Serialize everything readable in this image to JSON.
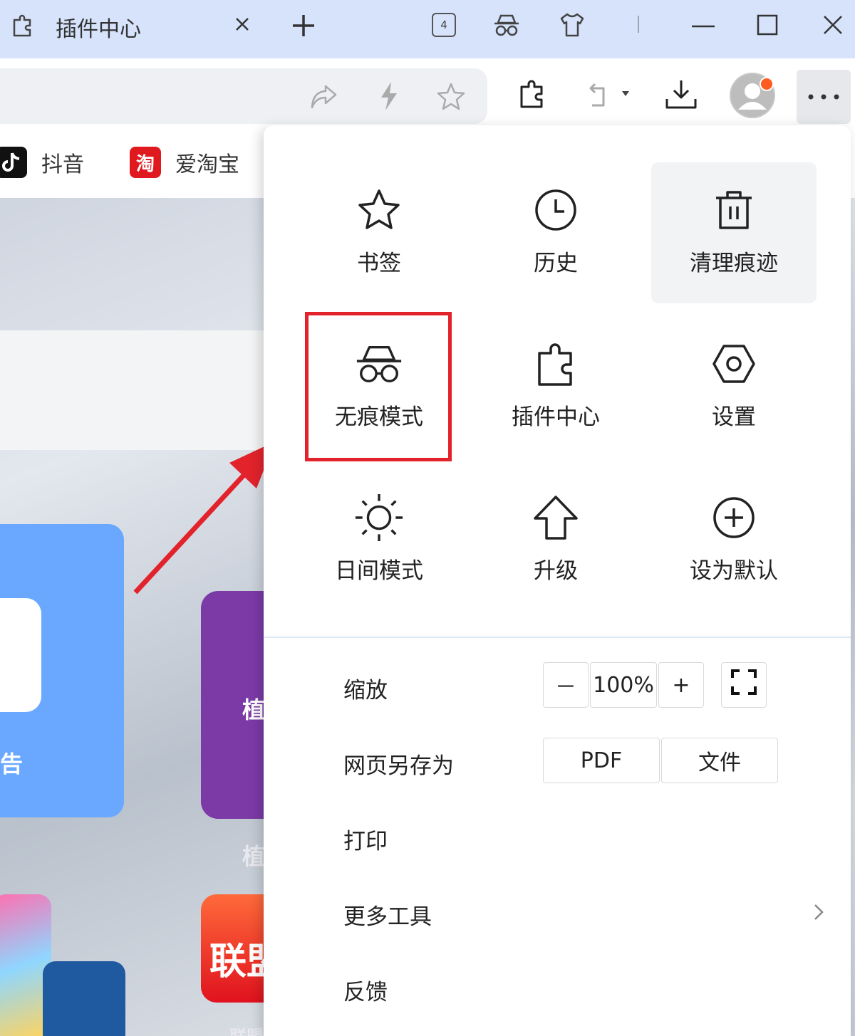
{
  "tab": {
    "title": "插件中心",
    "tab_count": "4"
  },
  "bookmarks": [
    {
      "label": "抖音",
      "icon": "douyin-icon"
    },
    {
      "label": "爱淘宝",
      "icon": "taobao-icon",
      "badge": "淘"
    }
  ],
  "page": {
    "card_text_1": "告",
    "card_text_2": "植",
    "card_text_3": "植",
    "card_text_4": "联盟",
    "card_text_5": "联盟"
  },
  "menu": {
    "grid": [
      {
        "label": "书签",
        "icon": "star-icon"
      },
      {
        "label": "历史",
        "icon": "clock-icon"
      },
      {
        "label": "清理痕迹",
        "icon": "trash-icon"
      },
      {
        "label": "无痕模式",
        "icon": "incognito-icon"
      },
      {
        "label": "插件中心",
        "icon": "puzzle-icon"
      },
      {
        "label": "设置",
        "icon": "settings-icon"
      },
      {
        "label": "日间模式",
        "icon": "sun-icon"
      },
      {
        "label": "升级",
        "icon": "upgrade-arrow-icon"
      },
      {
        "label": "设为默认",
        "icon": "plus-circle-icon"
      }
    ],
    "zoom": {
      "label": "缩放",
      "minus": "－",
      "value": "100%",
      "plus": "+"
    },
    "save_as": {
      "label": "网页另存为",
      "pdf": "PDF",
      "file": "文件"
    },
    "print": "打印",
    "more_tools": "更多工具",
    "feedback": "反馈"
  },
  "colors": {
    "accent_red": "#e3232c",
    "tab_bar": "#d6e3fb",
    "notification_dot": "#ff5a1f"
  }
}
